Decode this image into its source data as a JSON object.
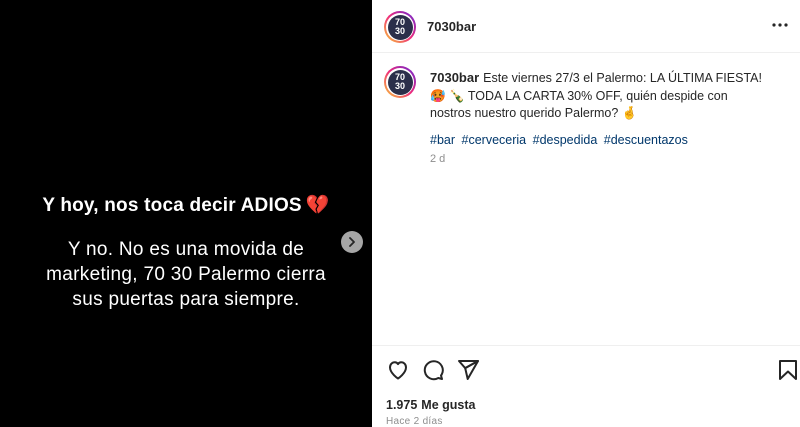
{
  "media": {
    "headline": "Y hoy, nos toca decir ADIOS",
    "headline_emoji": "💔",
    "body_lines": [
      "Y no. No es una movida de",
      "marketing, 70 30 Palermo cierra",
      "sus puertas para siempre."
    ],
    "next_icon": "chevron-right-icon"
  },
  "post": {
    "avatar_line1": "70",
    "avatar_line2": "30",
    "username": "7030bar",
    "more_icon": "more-horizontal-icon"
  },
  "caption": {
    "username": "7030bar",
    "text": "Este viernes 27/3 el Palermo: LA ÚLTIMA FIESTA! 🥵 🍾 TODA LA CARTA 30% OFF, quién despide con nostros nuestro querido Palermo? 🤞",
    "hashtags": [
      "#bar",
      "#cerveceria",
      "#despedida",
      "#descuentazos"
    ],
    "time": "2 d"
  },
  "actions": {
    "icons": [
      "heart-icon",
      "comment-icon",
      "share-icon",
      "bookmark-icon"
    ]
  },
  "likes": {
    "count": "1.975",
    "label": "Me gusta"
  },
  "timestamp": "Hace 2 días",
  "colors": {
    "media_bg": "#000000",
    "hashtag": "#00376b",
    "muted": "#8e8e8e",
    "heart": "#e0245e"
  }
}
